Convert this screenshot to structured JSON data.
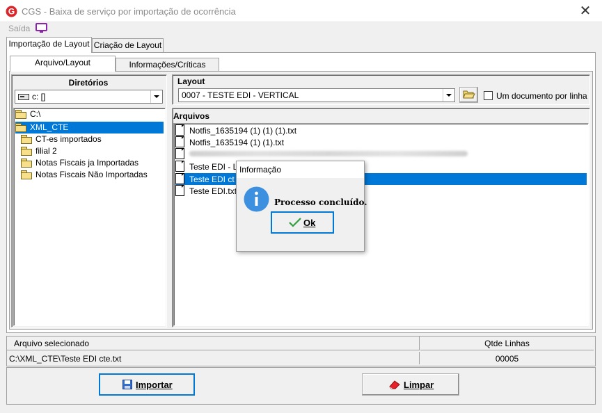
{
  "window": {
    "title": "CGS - Baixa de serviço por importação de ocorrência",
    "close": "✕"
  },
  "menu": {
    "saida": "Saída"
  },
  "tabs": [
    "Importação de Layout",
    "Criação de Layout"
  ],
  "subtabs": [
    "Arquivo/Layout",
    "Informações/Críticas"
  ],
  "diretorios": {
    "label": "Diretórios",
    "drive": "c: []",
    "tree": [
      {
        "label": "C:\\",
        "level": 0,
        "selected": false
      },
      {
        "label": "XML_CTE",
        "level": 0,
        "selected": true
      },
      {
        "label": "CT-es importados",
        "level": 1,
        "selected": false
      },
      {
        "label": "filial 2",
        "level": 1,
        "selected": false
      },
      {
        "label": "Notas Fiscais ja Importadas",
        "level": 1,
        "selected": false
      },
      {
        "label": "Notas Fiscais Não Importadas",
        "level": 1,
        "selected": false
      }
    ]
  },
  "layout": {
    "label": "Layout",
    "selected": "0007 - TESTE EDI - VERTICAL",
    "checkbox_label": "Um documento por linha",
    "checked": false
  },
  "arquivos": {
    "label": "Arquivos",
    "files": [
      {
        "name": "Notfis_1635194 (1) (1) (1).txt",
        "selected": false,
        "blurred": false
      },
      {
        "name": "Notfis_1635194 (1) (1).txt",
        "selected": false,
        "blurred": false
      },
      {
        "name": "",
        "selected": false,
        "blurred": true
      },
      {
        "name": "Teste EDI - L",
        "selected": false,
        "blurred": false
      },
      {
        "name": "Teste EDI ct",
        "selected": true,
        "blurred": false
      },
      {
        "name": "Teste EDI.txt",
        "selected": false,
        "blurred": false
      }
    ]
  },
  "status": {
    "arquivo_label": "Arquivo selecionado",
    "qtde_label": "Qtde Linhas",
    "arquivo_value": "C:\\XML_CTE\\Teste EDI cte.txt",
    "qtde_value": "00005"
  },
  "buttons": {
    "importar": "Importar",
    "limpar": "Limpar"
  },
  "dialog": {
    "title": "Informação",
    "message": "Processo concluído.",
    "ok": "Ok"
  },
  "colors": {
    "selection": "#0078d7",
    "logo": "#d9262a",
    "info": "#3d8fe0",
    "purple": "#8e24aa"
  }
}
